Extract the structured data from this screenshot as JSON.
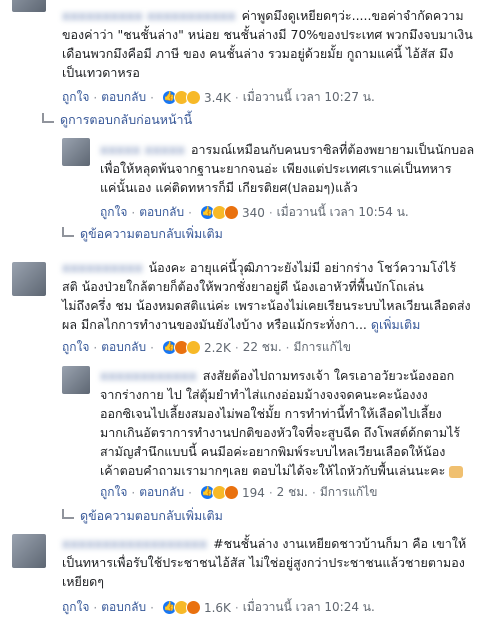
{
  "comments": [
    {
      "lines": [
        "ค่าพูดมึงดูเหยียดๆว่ะ.....ขอค่าจำกัดความ",
        "ของค่าว่า \"ชนชั้นล่าง\" หน่อย ชนชั้นล่างมี 70%ของประเทศ พวกมึงจบมาเงิน",
        "เดือนพวกมึงคือมี ภาษี ของ คนชั้นล่าง รวมอยู่ด้วยมั้ย กูถามแค่นี้ ไอ้สัส มึง",
        "เป็นเทวดาหรอ"
      ],
      "actions": {
        "like": "ถูกใจ",
        "reply": "ตอบกลับ",
        "count": "3.4K",
        "time": "เมื่อวานนี้ เวลา 10:27 น."
      },
      "reply_link": "ดูการตอบกลับก่อนหน้านี้"
    },
    {
      "lines": [
        "อารมณ์เหมือนกับคนบราซิลที่ต้องพยายามเป็นนักบอล",
        "เพื่อให้หลุดพ้นจากฐานะยากจนอ่ะ เพียงแต่ประเทศเราแค่เป็นทหาร",
        "แค่นั้นเอง แค่ติดทหารก็มี เกียรติยศ(ปลอมๆ)แล้ว"
      ],
      "actions": {
        "like": "ถูกใจ",
        "reply": "ตอบกลับ",
        "count": "340",
        "time": "เมื่อวานนี้ เวลา 10:54 น."
      },
      "reply_link": "ดูข้อความตอบกลับเพิ่มเติม"
    },
    {
      "lines": [
        "น้องคะ อายุแค่นี้วุฒิภาวะยังไม่มี อย่ากร่าง โชว์ความโง่ไร้",
        "สติ น้องป่วยใกล้ตายก็ต้องให้พวกชั่งยาอยู่ดี น้องเอาหัวที่พื้นบักโถเล่น",
        "ไม่ถึงครึ่ง ชม น้องหมดสติแน่ค่ะ เพราะน้องไม่เคยเรียนระบบไหลเวียนเลือดส่ง",
        "ผล มีกลไกการทำงานของมันยังไงบ้าง หรือแม้กระทั่งกา...",
        "ดูเพิ่มเติม"
      ],
      "actions": {
        "like": "ถูกใจ",
        "reply": "ตอบกลับ",
        "count": "2.2K",
        "time": "22 ชม.",
        "edited": "มีการแก้ไข"
      }
    },
    {
      "lines": [
        "สงสัยต้องไปถามทรงเจ้า ใครเอาอวัยวะน้องออก",
        "จากร่างกาย ไป ใส่ตุ้มยำทำไส่แกงอ่อมม้างจงจดคนะคะน้องงง",
        "ออกซิเจนไปเลี้ยงสมองไม่พอใช่มั้ย การทำท่านี้ทำให้เลือดไปเลี้ยง",
        "มากเกินอัตราการทำงานปกติของหัวใจที่จะสูบฉีด ถึงโพสต์ด้กตามไร้",
        "สามัญสำนึกแบบนี้ คนมีอค่ะอยากพิมพ์ระบบไหลเวียนเลือดให้น้อง",
        "เค้าตอบคำถามเรามากๆเลย ตอบไม่ได้จะให้ไถหัวกับพื้นเล่นนะคะ"
      ],
      "actions": {
        "like": "ถูกใจ",
        "reply": "ตอบกลับ",
        "count": "194",
        "time": "2 ชม.",
        "edited": "มีการแก้ไข"
      },
      "reply_link": "ดูข้อความตอบกลับเพิ่มเติม"
    },
    {
      "lines": [
        "#ชนชั้นล่าง งานเหยียดชาวบ้านก็มา คือ เขาให้",
        "เป็นทหารเพื่อรับใช้ประชาชนไอ้สัส ไม่ใช่อยู่สูงกว่าประชาชนแล้วชายตามอง",
        "เหยียดๆ"
      ],
      "actions": {
        "like": "ถูกใจ",
        "reply": "ตอบกลับ",
        "count": "1.6K",
        "time": "เมื่อวานนี้ เวลา 10:24 น."
      }
    }
  ]
}
